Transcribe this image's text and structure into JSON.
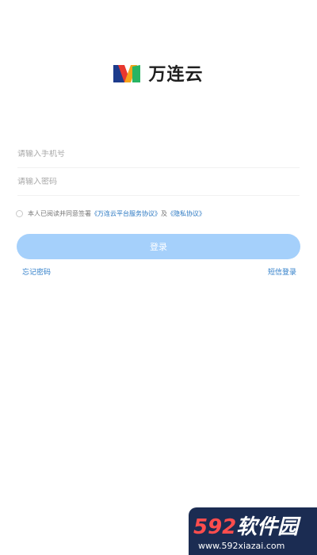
{
  "app": {
    "name": "万连云"
  },
  "login": {
    "phone_placeholder": "请输入手机号",
    "password_placeholder": "请输入密码",
    "agreement_prefix": "本人已阅读并同意签署",
    "service_agreement": "《万连云平台服务协议》",
    "agreement_and": "及",
    "privacy_agreement": "《隐私协议》",
    "submit_label": "登录",
    "forgot_label": "忘记密码",
    "sms_label": "短信登录"
  },
  "watermark": {
    "number": "592",
    "chinese": "软件园",
    "url": "www.592xiazai.com"
  },
  "colors": {
    "accent": "#a5d0fb",
    "link": "#2f7ec9",
    "watermark_bg": "#1b2c52",
    "watermark_number": "#ff4d4d"
  }
}
